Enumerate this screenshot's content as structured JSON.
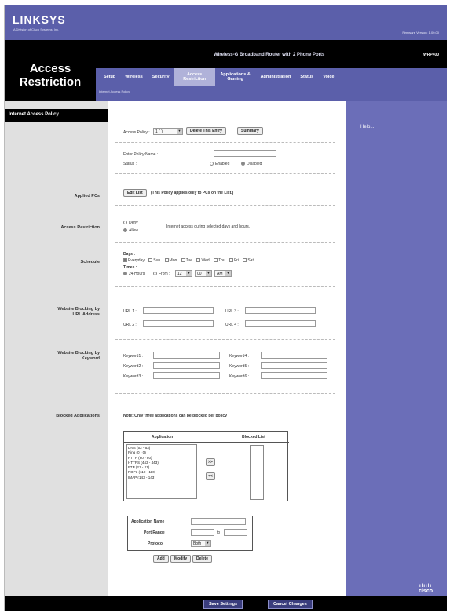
{
  "brand": {
    "logo": "LINKSYS",
    "subtitle": "A Division of Cisco Systems, Inc.",
    "firmware": "Firmware Version: 1.00.00"
  },
  "section_title": "Access Restriction",
  "model": {
    "name": "Wireless-G Broadband Router with 2 Phone Ports",
    "number": "WRP400"
  },
  "tabs": [
    {
      "label": "Setup"
    },
    {
      "label": "Wireless"
    },
    {
      "label": "Security"
    },
    {
      "label": "Access Restriction",
      "active": true
    },
    {
      "label": "Applications & Gaming"
    },
    {
      "label": "Administration"
    },
    {
      "label": "Status"
    },
    {
      "label": "Voice"
    }
  ],
  "subtab": "Internet Access Policy",
  "left_labels": {
    "header": "Internet Access Policy",
    "applied_pcs": "Applied PCs",
    "access_restriction": "Access Restriction",
    "schedule": "Schedule",
    "website_url": "Website Blocking by URL Address",
    "website_keyword": "Website Blocking by Keyword",
    "blocked_apps": "Blocked Applications"
  },
  "help": "Help...",
  "policy": {
    "access_policy_label": "Access Policy :",
    "access_policy_value": "1 ( )",
    "delete_btn": "Delete This Entry",
    "summary_btn": "Summary",
    "name_label": "Enter Policy Name :",
    "status_label": "Status :",
    "enabled": "Enabled",
    "disabled": "Disabled"
  },
  "applied": {
    "edit_btn": "Edit List",
    "note": "(This Policy applies only to PCs on the List.)"
  },
  "restriction": {
    "deny": "Deny",
    "allow": "Allow",
    "desc": "Internet access during selected days and hours."
  },
  "schedule": {
    "days_label": "Days :",
    "days": [
      "Everyday",
      "Sun",
      "Mon",
      "Tue",
      "Wed",
      "Thu",
      "Fri",
      "Sat"
    ],
    "times_label": "Times :",
    "hours24": "24 Hours",
    "from": "From :",
    "hour": "12",
    "minute": "00",
    "ampm": "AM"
  },
  "urls": {
    "u1": "URL 1 :",
    "u2": "URL 2 :",
    "u3": "URL 3 :",
    "u4": "URL 4 :"
  },
  "keywords": {
    "k1": "Keyword1 :",
    "k2": "Keyword2 :",
    "k3": "Keyword3 :",
    "k4": "Keyword4 :",
    "k5": "Keyword5 :",
    "k6": "Keyword6 :"
  },
  "blocked": {
    "note": "Note: Only three applications can be blocked per policy",
    "app_header": "Application",
    "blocked_header": "Blocked List",
    "apps": [
      "DNS  (53 - 53)",
      "Ping  (0 - 0)",
      "HTTP  (80 - 80)",
      "HTTPS  (443 - 443)",
      "FTP  (21 - 21)",
      "POP3  (110 - 110)",
      "IMAP  (143 - 143)"
    ],
    "add_arrow": ">>",
    "remove_arrow": "<<"
  },
  "app_form": {
    "name_label": "Application Name",
    "port_label": "Port Range",
    "to": "to",
    "protocol_label": "Protocol",
    "protocol_value": "Both",
    "add": "Add",
    "modify": "Modify",
    "delete": "Delete"
  },
  "footer": {
    "save": "Save Settings",
    "cancel": "Cancel Changes",
    "cisco": "cisco"
  }
}
